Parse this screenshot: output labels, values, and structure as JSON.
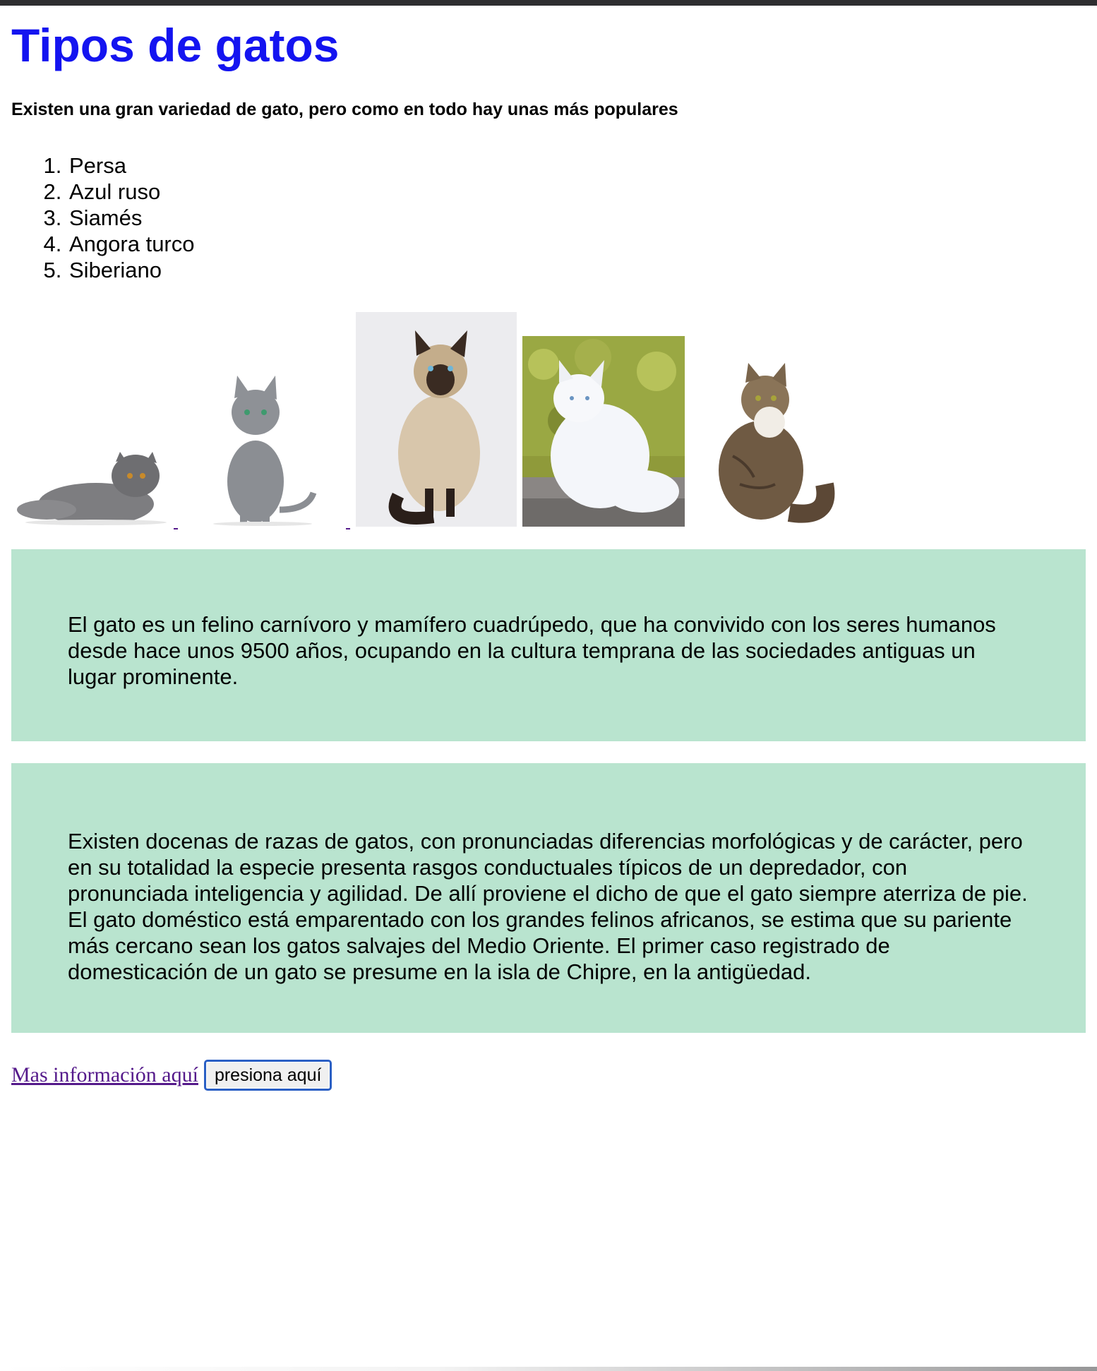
{
  "page": {
    "title": "Tipos de gatos",
    "intro": "Existen una gran variedad de gato, pero como en todo hay unas más populares"
  },
  "breeds": [
    "Persa",
    "Azul ruso",
    "Siamés",
    "Angora turco",
    "Siberiano"
  ],
  "gallery": {
    "images": [
      {
        "breed": "Persa",
        "icon": "persian-cat-photo"
      },
      {
        "breed": "Azul ruso",
        "icon": "russian-blue-cat-photo"
      },
      {
        "breed": "Siamés",
        "icon": "siamese-cat-photo"
      },
      {
        "breed": "Angora turco",
        "icon": "turkish-angora-cat-photo"
      },
      {
        "breed": "Siberiano",
        "icon": "siberian-cat-photo"
      }
    ]
  },
  "info": {
    "paragraph1": "El gato es un felino carnívoro y mamífero cuadrúpedo, que ha convivido con los seres humanos desde hace unos 9500 años, ocupando en la cultura temprana de las sociedades antiguas un lugar prominente.",
    "paragraph2": "Existen docenas de razas de gatos, con pronunciadas diferencias morfológicas y de carácter, pero en su totalidad la especie presenta rasgos conductuales típicos de un depredador, con pronunciada inteligencia y agilidad. De allí proviene el dicho de que el gato siempre aterriza de pie. El gato doméstico está emparentado con los grandes felinos africanos, se estima que su pariente más cercano sean los gatos salvajes del Medio Oriente. El primer caso registrado de domesticación de un gato se presume en la isla de Chipre, en la antigüedad."
  },
  "footer": {
    "link_label": "Mas información aquí",
    "button_label": "presiona aquí"
  },
  "colors": {
    "title": "#1414f0",
    "box_background": "#b9e4cf",
    "link": "#551a8b",
    "button_border": "#2a5fc4"
  }
}
